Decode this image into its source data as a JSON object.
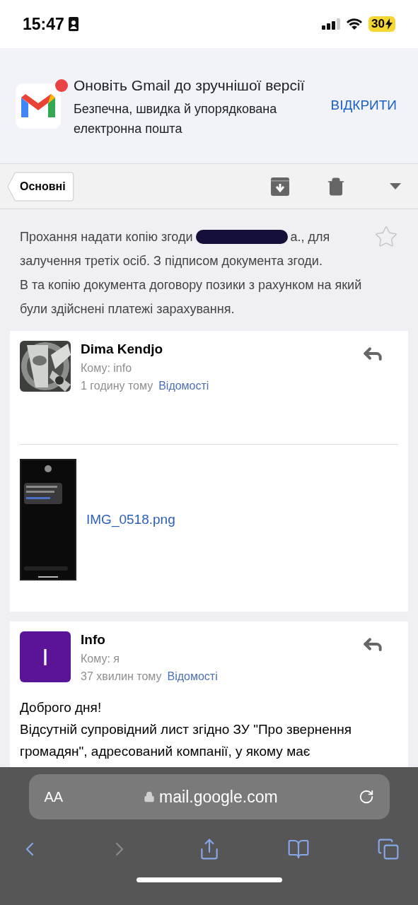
{
  "status_bar": {
    "time": "15:47",
    "battery": "30",
    "charging": true
  },
  "banner": {
    "title": "Оновіть Gmail до зручнішої версії",
    "subtitle": "Безпечна, швидка й упорядкована електронна пошта",
    "action": "ВІДКРИТИ",
    "badge": true
  },
  "toolbar": {
    "back_label": "Основні"
  },
  "subject": {
    "before": "Прохання надати копію згоди",
    "after": "а., для",
    "line2": "залучення третіх осіб. З підписом документа згоди.",
    "continuation": "В та копію документа договору позики з рахунком на який були здійснені платежі зарахування.",
    "starred": false
  },
  "messages": [
    {
      "kind": "attachment",
      "sender": "Dima Kendjo",
      "to": "Кому: info",
      "time": "1 годину тому",
      "details": "Відомості",
      "attachment": {
        "name": "IMG_0518.png"
      }
    },
    {
      "kind": "text",
      "sender": "Info",
      "avatar": {
        "kind": "letter",
        "letter": "I",
        "color": "#5b1495"
      },
      "to": "Кому: я",
      "time": "37 хвилин тому",
      "details": "Відомості",
      "body": [
        "Доброго дня!",
        "Відсутній супровідний лист згідно ЗУ \"Про звернення громадян\", адресований компанії, у якому має"
      ]
    }
  ],
  "browser": {
    "text_size": "AA",
    "url": "mail.google.com",
    "nav": [
      {
        "kind": "back",
        "disabled": false
      },
      {
        "kind": "forward",
        "disabled": true
      },
      {
        "kind": "share",
        "disabled": false
      },
      {
        "kind": "bookmarks",
        "disabled": false
      },
      {
        "kind": "tabs",
        "disabled": false
      }
    ]
  }
}
